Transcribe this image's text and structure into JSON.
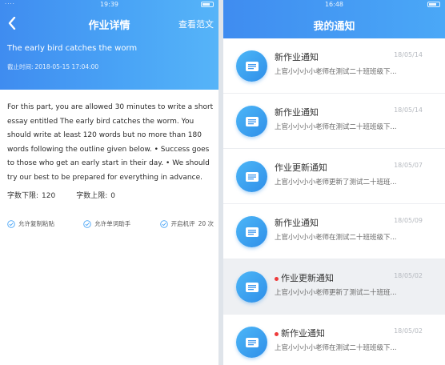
{
  "left": {
    "status_time": "19:39",
    "status_left": "····",
    "nav_title": "作业详情",
    "sample_link": "查看范文",
    "essay_title": "The early bird catches the worm",
    "deadline_label": "截止时间:",
    "deadline_value": "2018-05-15 17:04:00",
    "prompt": "For this part, you are allowed 30 minutes to write a short essay entitled The early bird catches the worm. You should write at least 120 words but no more than 180 words following the outline given below. • Success goes to those who get an early start in their day. • We should try our best to be prepared for everything in advance.",
    "word_min_label": "字数下限:",
    "word_min": "120",
    "word_max_label": "字数上限:",
    "word_max": "0",
    "options": [
      {
        "label": "允许复制粘贴"
      },
      {
        "label": "允许单词助手"
      },
      {
        "label": "开启机评",
        "count": "20 次"
      }
    ]
  },
  "right": {
    "status_time": "16:48",
    "nav_title": "我的通知",
    "notices": [
      {
        "title": "新作业通知",
        "date": "18/05/14",
        "preview": "上官小小小小老师在测试二十班班级下...",
        "unread": false
      },
      {
        "title": "新作业通知",
        "date": "18/05/14",
        "preview": "上官小小小小老师在测试二十班班级下...",
        "unread": false
      },
      {
        "title": "作业更新通知",
        "date": "18/05/07",
        "preview": "上官小小小小老师更新了测试二十班班...",
        "unread": false
      },
      {
        "title": "新作业通知",
        "date": "18/05/09",
        "preview": "上官小小小小老师在测试二十班班级下...",
        "unread": false
      },
      {
        "title": "作业更新通知",
        "date": "18/05/02",
        "preview": "上官小小小小老师更新了测试二十班班...",
        "unread": true
      },
      {
        "title": "新作业通知",
        "date": "18/05/02",
        "preview": "上官小小小小老师在测试二十班班级下...",
        "unread": true
      }
    ]
  },
  "colors": {
    "brand_blue": "#3f8cf0",
    "unread_red": "#ee3b3b"
  }
}
